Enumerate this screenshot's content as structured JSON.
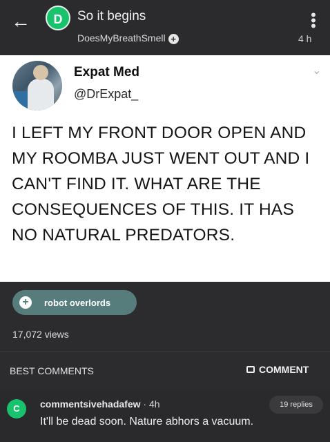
{
  "header": {
    "back_icon": "arrow-left-icon",
    "avatar_letter": "D",
    "title": "So it begins",
    "author": "DoesMyBreathSmell",
    "follow_icon": "plus-icon",
    "menu_icon": "more-vertical-icon",
    "time": "4 h"
  },
  "tweet": {
    "name": "Expat Med",
    "handle": "@DrExpat_",
    "chevron_icon": "chevron-down-icon",
    "text": "I LEFT MY FRONT DOOR OPEN AND MY ROOMBA JUST WENT OUT AND I CAN'T FIND IT. WHAT ARE THE CONSEQUENCES OF THIS. IT HAS NO NATURAL PREDATORS."
  },
  "tag": {
    "label": "robot overlords",
    "color": "#567d7b"
  },
  "stats": {
    "views": "17,072 views"
  },
  "comments_header": {
    "best_label": "BEST COMMENTS",
    "comment_button": "COMMENT"
  },
  "comment": {
    "avatar_letter": "C",
    "username": "commentsivehadafew",
    "separator": "·",
    "time": "4h",
    "replies": "19 replies",
    "text": "It'll be dead soon. Nature abhors a vacuum."
  },
  "colors": {
    "background": "#2c2c2e",
    "accent_green": "#19c36e"
  }
}
